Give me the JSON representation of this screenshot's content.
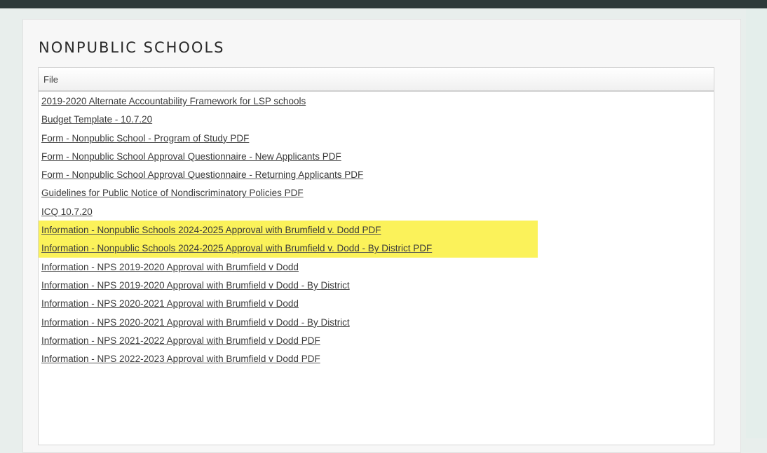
{
  "colors": {
    "top_bar": "#2e3a3a",
    "background": "#e8eeec",
    "card": "#f7f7f7",
    "highlight": "#fbf25a",
    "link_text": "#3a3a3a"
  },
  "page": {
    "title": "NONPUBLIC SCHOOLS"
  },
  "table": {
    "header": "File",
    "rows": [
      {
        "label": "2019-2020 Alternate Accountability Framework for LSP schools",
        "highlighted": false
      },
      {
        "label": "Budget Template - 10.7.20",
        "highlighted": false
      },
      {
        "label": "Form - Nonpublic School - Program of Study PDF",
        "highlighted": false
      },
      {
        "label": "Form - Nonpublic School Approval Questionnaire - New Applicants PDF",
        "highlighted": false
      },
      {
        "label": "Form - Nonpublic School Approval Questionnaire - Returning Applicants PDF",
        "highlighted": false
      },
      {
        "label": "Guidelines for Public Notice of Nondiscriminatory Policies PDF",
        "highlighted": false
      },
      {
        "label": "ICQ 10.7.20",
        "highlighted": false
      },
      {
        "label": "Information - Nonpublic Schools 2024-2025 Approval with Brumfield v. Dodd PDF",
        "highlighted": true
      },
      {
        "label": "Information - Nonpublic Schools 2024-2025 Approval with Brumfield v. Dodd - By District PDF",
        "highlighted": true
      },
      {
        "label": "Information - NPS 2019-2020 Approval with Brumfield v Dodd",
        "highlighted": false
      },
      {
        "label": "Information - NPS 2019-2020 Approval with Brumfield v Dodd - By District",
        "highlighted": false
      },
      {
        "label": "Information - NPS 2020-2021 Approval with Brumfield v Dodd",
        "highlighted": false
      },
      {
        "label": "Information - NPS 2020-2021 Approval with Brumfield v Dodd - By District",
        "highlighted": false
      },
      {
        "label": "Information - NPS 2021-2022 Approval with Brumfield v Dodd PDF",
        "highlighted": false
      },
      {
        "label": "Information - NPS 2022-2023 Approval with Brumfield v Dodd PDF",
        "highlighted": false
      }
    ]
  }
}
